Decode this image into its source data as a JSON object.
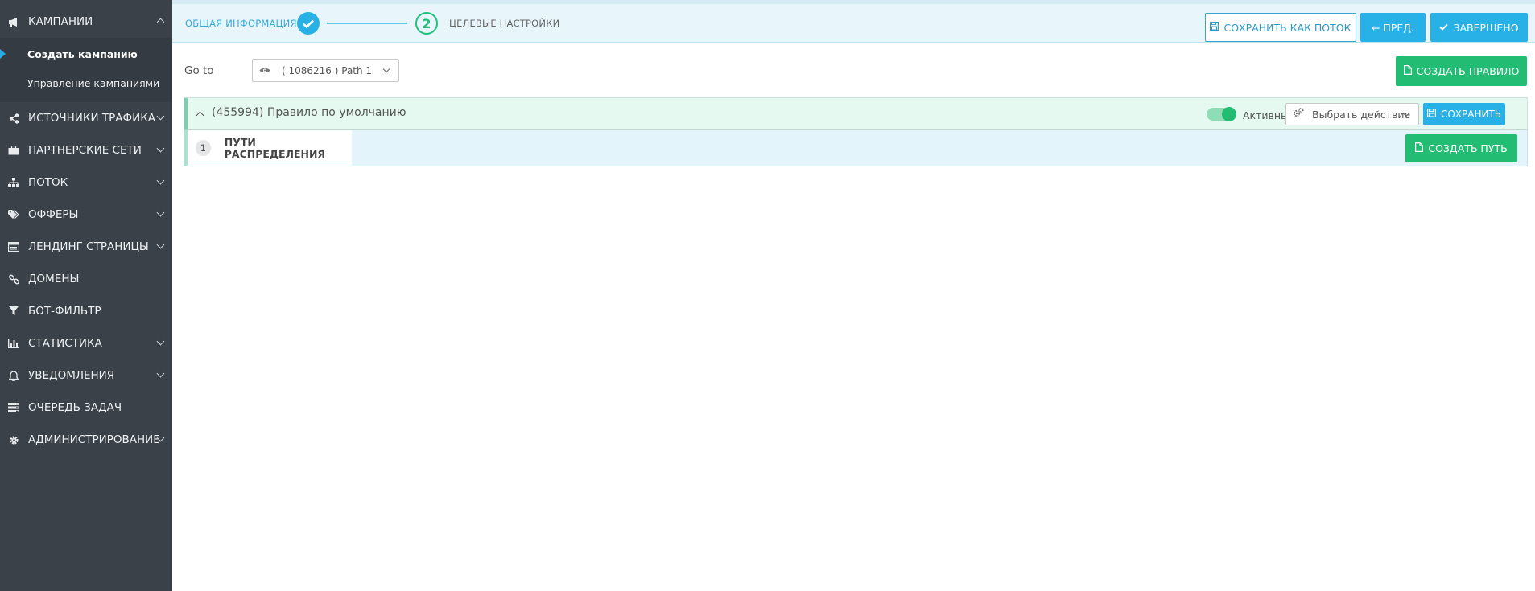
{
  "sidebar": {
    "campaigns": {
      "label": "КАМПАНИИ",
      "icon": "megaphone-icon"
    },
    "campaigns_sub": [
      {
        "label": "Создать кампанию",
        "active": true
      },
      {
        "label": "Управление кампаниями",
        "active": false
      }
    ],
    "items": [
      {
        "label": "ИСТОЧНИКИ ТРАФИКА",
        "icon": "share-icon",
        "has_chevron": true
      },
      {
        "label": "ПАРТНЕРСКИЕ СЕТИ",
        "icon": "briefcase-icon",
        "has_chevron": true
      },
      {
        "label": "ПОТОК",
        "icon": "sitemap-icon",
        "has_chevron": true
      },
      {
        "label": "ОФФЕРЫ",
        "icon": "tags-icon",
        "has_chevron": true
      },
      {
        "label": "ЛЕНДИНГ СТРАНИЦЫ",
        "icon": "window-icon",
        "has_chevron": true
      },
      {
        "label": "ДОМЕНЫ",
        "icon": "link-icon",
        "has_chevron": false
      },
      {
        "label": "БОТ-ФИЛЬТР",
        "icon": "filter-icon",
        "has_chevron": false
      },
      {
        "label": "СТАТИСТИКА",
        "icon": "bar-chart-icon",
        "has_chevron": true
      },
      {
        "label": "УВЕДОМЛЕНИЯ",
        "icon": "bell-icon",
        "has_chevron": true
      },
      {
        "label": "ОЧЕРЕДЬ ЗАДАЧ",
        "icon": "tasks-icon",
        "has_chevron": false
      },
      {
        "label": "АДМИНИСТРИРОВАНИЕ",
        "icon": "gear-icon",
        "has_chevron": true
      }
    ]
  },
  "wizard": {
    "step1_label": "ОБЩАЯ ИНФОРМАЦИЯ",
    "step2_number": "2",
    "step2_label": "ЦЕЛЕВЫЕ НАСТРОЙКИ",
    "save_as_flow": "СОХРАНИТЬ КАК ПОТОК",
    "prev": "← ПРЕД.",
    "done": "ЗАВЕРШЕНО"
  },
  "goto": {
    "label": "Go to",
    "selected": "( 1086216 ) Path 1"
  },
  "create_rule": "СОЗДАТЬ ПРАВИЛО",
  "rule": {
    "title": "(455994) Правило по умолчанию",
    "active_label": "Активный",
    "active": true,
    "action_placeholder": "Выбрать действие",
    "save": "СОХРАНИТЬ",
    "paths_count": "1",
    "paths_label": "ПУТИ РАСПРЕДЕЛЕНИЯ",
    "create_path": "СОЗДАТЬ ПУТЬ"
  },
  "colors": {
    "sidebar_bg": "#3a4148",
    "accent_blue": "#28b1e6",
    "accent_green": "#22bd73"
  }
}
